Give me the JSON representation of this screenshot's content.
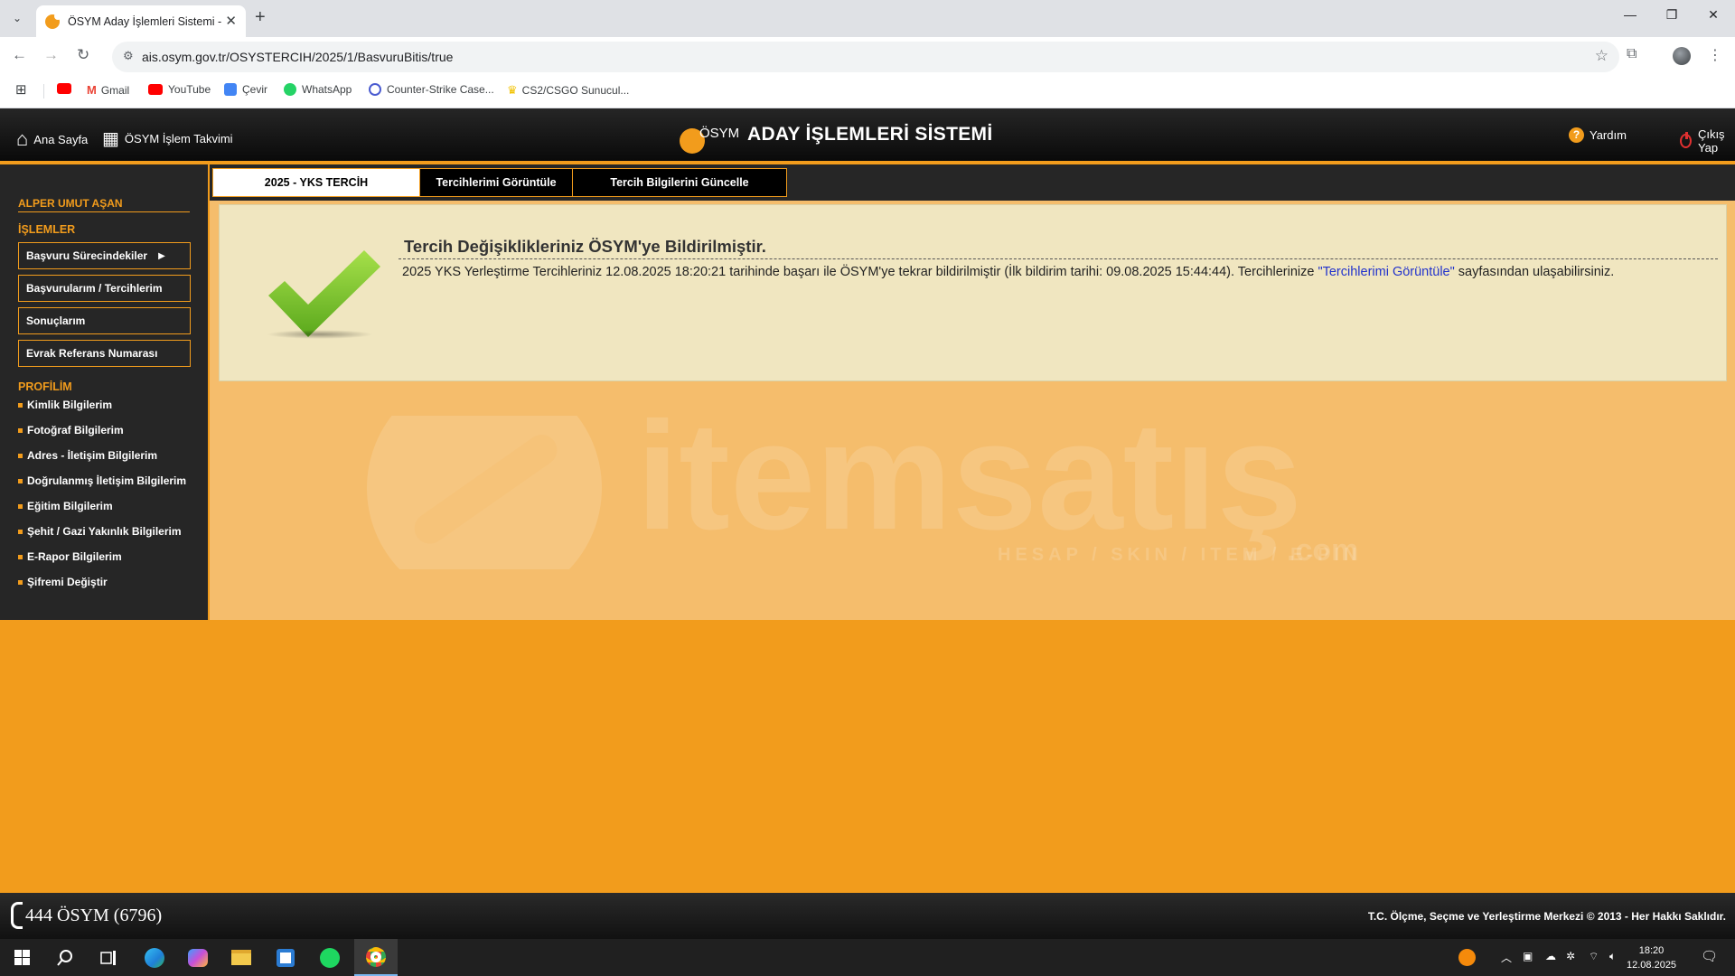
{
  "browser": {
    "tab_title": "ÖSYM Aday İşlemleri Sistemi - ",
    "url": "ais.osym.gov.tr/OSYSTERCIH/2025/1/BasvuruBitis/true",
    "bookmarks": [
      {
        "label": ""
      },
      {
        "label": "Gmail"
      },
      {
        "label": "YouTube"
      },
      {
        "label": "Çevir"
      },
      {
        "label": "WhatsApp"
      },
      {
        "label": "Counter-Strike Case..."
      },
      {
        "label": "CS2/CSGO Sunucul..."
      }
    ]
  },
  "header": {
    "home_label": "Ana Sayfa",
    "calendar_label": "ÖSYM İşlem Takvimi",
    "logo_text": "ÖSYM",
    "title": "ADAY İŞLEMLERİ SİSTEMİ",
    "help_label": "Yardım",
    "logout_label": "Çıkış Yap"
  },
  "sidebar": {
    "user_name": "ALPER UMUT AŞAN",
    "operations_title": "İŞLEMLER",
    "operations": [
      {
        "label": "Başvuru Sürecindekiler"
      },
      {
        "label": "Başvurularım / Tercihlerim"
      },
      {
        "label": "Sonuçlarım"
      },
      {
        "label": "Evrak Referans Numarası"
      }
    ],
    "profile_title": "PROFİLİM",
    "profile_links": [
      {
        "label": "Kimlik Bilgilerim"
      },
      {
        "label": "Fotoğraf Bilgilerim"
      },
      {
        "label": "Adres - İletişim Bilgilerim"
      },
      {
        "label": "Doğrulanmış İletişim Bilgilerim"
      },
      {
        "label": "Eğitim Bilgilerim"
      },
      {
        "label": "Şehit / Gazi Yakınlık Bilgilerim"
      },
      {
        "label": "E-Rapor Bilgilerim"
      },
      {
        "label": "Şifremi Değiştir"
      }
    ]
  },
  "content": {
    "tabs": [
      {
        "label": "2025 - YKS TERCİH"
      },
      {
        "label": "Tercihlerimi Görüntüle"
      },
      {
        "label": "Tercih Bilgilerini Güncelle"
      }
    ],
    "message_title": "Tercih Değişiklikleriniz ÖSYM'ye Bildirilmiştir.",
    "message_before": "2025 YKS Yerleştirme Tercihleriniz 12.08.2025 18:20:21 tarihinde başarı ile ÖSYM'ye tekrar bildirilmiştir (İlk bildirim tarihi: 09.08.2025 15:44:44). Tercihlerinize ",
    "message_link": "\"Tercihlerimi Görüntüle\"",
    "message_after": " sayfasından ulaşabilirsiniz."
  },
  "watermark": {
    "brand": "itemsatış",
    "tagline": "HESAP / SKIN / ITEM / E-PIN",
    "suffix": ".com"
  },
  "footer": {
    "phone": "444 ÖSYM (6796)",
    "copyright": "T.C. Ölçme, Seçme ve Yerleştirme Merkezi © 2013 - Her Hakkı Saklıdır."
  },
  "taskbar": {
    "time": "18:20",
    "date": "12.08.2025"
  },
  "colors": {
    "accent": "#f29c1c",
    "header_bg": "#1a1a1a",
    "message_bg": "#f0e6c0",
    "check_green": "#7cc52a"
  }
}
